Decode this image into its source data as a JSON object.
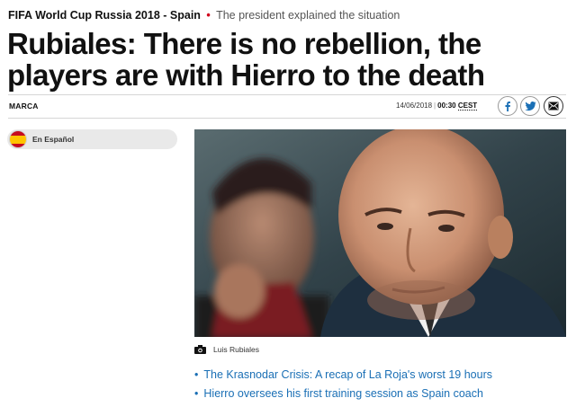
{
  "article": {
    "section": "FIFA World Cup Russia 2018 - Spain",
    "separator": "•",
    "subtitle": "The president explained the situation",
    "headline": "Rubiales: There is no rebellion, the players are with Hierro to the death",
    "author": "MARCA",
    "date": "14/06/2018",
    "divider": "|",
    "time": "00:30",
    "timezone": "CEST"
  },
  "share": {
    "icons": [
      "facebook-icon",
      "twitter-icon",
      "email-icon"
    ]
  },
  "language": {
    "label": "En Español",
    "flag_colors": {
      "red": "#c60b1e",
      "yellow": "#ffc400"
    }
  },
  "photo": {
    "caption": "Luis Rubiales"
  },
  "related": {
    "bullet": "•",
    "items": [
      {
        "text": "The Krasnodar Crisis: A recap of La Roja's worst 19 hours"
      },
      {
        "text": "Hierro oversees his first training session as Spain coach"
      }
    ]
  },
  "colors": {
    "accent_red": "#d0021b",
    "link_blue": "#1a6fb5",
    "rule_gray": "#d6d6d6"
  }
}
